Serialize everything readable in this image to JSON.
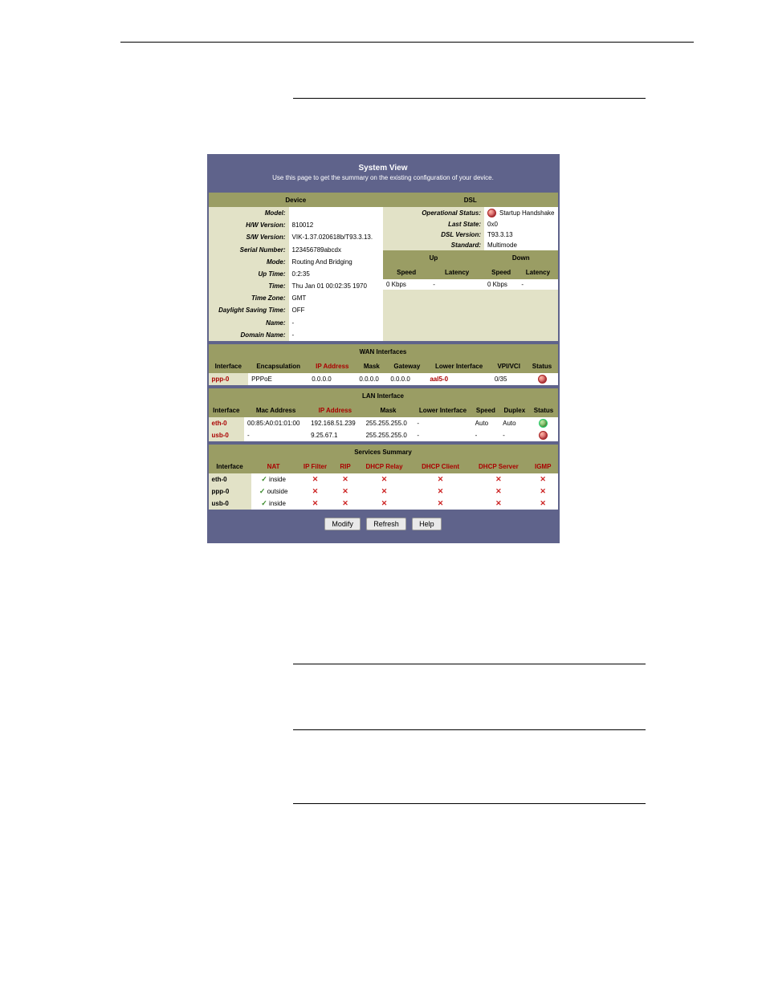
{
  "panel": {
    "title": "System View",
    "desc": "Use this page to get the summary on the existing configuration of your device."
  },
  "device": {
    "head": "Device",
    "rows": [
      {
        "label": "Model:",
        "value": ""
      },
      {
        "label": "H/W Version:",
        "value": "810012"
      },
      {
        "label": "S/W Version:",
        "value": "VIK-1.37.020618b/T93.3.13."
      },
      {
        "label": "Serial Number:",
        "value": "123456789abcdx"
      },
      {
        "label": "Mode:",
        "value": "Routing And Bridging"
      },
      {
        "label": "Up Time:",
        "value": "0:2:35"
      },
      {
        "label": "Time:",
        "value": "Thu Jan 01 00:02:35 1970"
      },
      {
        "label": "Time Zone:",
        "value": "GMT"
      },
      {
        "label": "Daylight Saving Time:",
        "value": "OFF"
      },
      {
        "label": "Name:",
        "value": "-"
      },
      {
        "label": "Domain Name:",
        "value": "-"
      }
    ]
  },
  "dsl": {
    "head": "DSL",
    "rows": [
      {
        "label": "Operational Status:",
        "value": "Startup Handshake"
      },
      {
        "label": "Last State:",
        "value": "0x0"
      },
      {
        "label": "DSL Version:",
        "value": "T93.3.13"
      },
      {
        "label": "Standard:",
        "value": "Multimode"
      }
    ],
    "updown": {
      "up": "Up",
      "down": "Down",
      "speed": "Speed",
      "latency": "Latency",
      "values": [
        "0 Kbps",
        "-",
        "0 Kbps",
        "-"
      ]
    }
  },
  "wan": {
    "head": "WAN Interfaces",
    "cols": [
      "Interface",
      "Encapsulation",
      "IP Address",
      "Mask",
      "Gateway",
      "Lower Interface",
      "VPI/VCI",
      "Status"
    ],
    "rows": [
      {
        "iface": "ppp-0",
        "encap": "PPPoE",
        "ip": "0.0.0.0",
        "mask": "0.0.0.0",
        "gw": "0.0.0.0",
        "lower": "aal5-0",
        "vpi": "0/35",
        "status": "red"
      }
    ]
  },
  "lan": {
    "head": "LAN Interface",
    "cols": [
      "Interface",
      "Mac Address",
      "IP Address",
      "Mask",
      "Lower Interface",
      "Speed",
      "Duplex",
      "Status"
    ],
    "rows": [
      {
        "iface": "eth-0",
        "mac": "00:85:A0:01:01:00",
        "ip": "192.168.51.239",
        "mask": "255.255.255.0",
        "lower": "-",
        "speed": "Auto",
        "duplex": "Auto",
        "status": "green"
      },
      {
        "iface": "usb-0",
        "mac": "-",
        "ip": "9.25.67.1",
        "mask": "255.255.255.0",
        "lower": "-",
        "speed": "-",
        "duplex": "-",
        "status": "red"
      }
    ]
  },
  "services": {
    "head": "Services Summary",
    "cols": [
      "Interface",
      "NAT",
      "IP Filter",
      "RIP",
      "DHCP Relay",
      "DHCP Client",
      "DHCP Server",
      "IGMP"
    ],
    "rows": [
      {
        "iface": "eth-0",
        "nat": "inside"
      },
      {
        "iface": "ppp-0",
        "nat": "outside"
      },
      {
        "iface": "usb-0",
        "nat": "inside"
      }
    ]
  },
  "buttons": {
    "modify": "Modify",
    "refresh": "Refresh",
    "help": "Help"
  }
}
